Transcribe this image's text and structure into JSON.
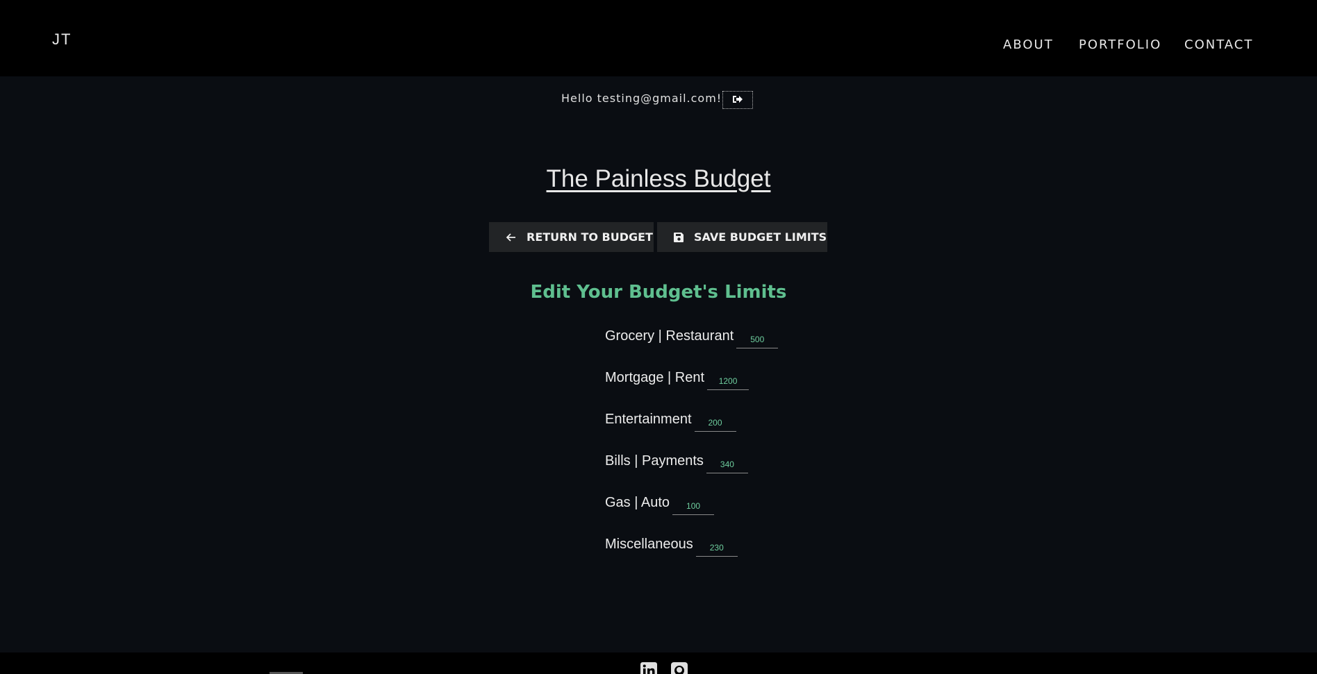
{
  "header": {
    "logo": "JT",
    "nav": [
      "ABOUT",
      "PORTFOLIO",
      "CONTACT"
    ]
  },
  "user": {
    "greeting": "Hello testing@gmail.com!",
    "logout_icon": "sign-out-icon"
  },
  "page": {
    "title": "The Painless Budget",
    "return_label": "RETURN TO BUDGET",
    "return_icon": "arrow-left-icon",
    "save_label": "SAVE BUDGET LIMITS",
    "save_icon": "floppy-disk-icon",
    "subheading": "Edit Your Budget's Limits"
  },
  "limits": [
    {
      "label": "Grocery | Restaurant",
      "value": "500"
    },
    {
      "label": "Mortgage | Rent",
      "value": "1200"
    },
    {
      "label": "Entertainment",
      "value": "200"
    },
    {
      "label": "Bills | Payments",
      "value": "340"
    },
    {
      "label": "Gas | Auto",
      "value": "100"
    },
    {
      "label": "Miscellaneous",
      "value": "230"
    }
  ],
  "footer": {
    "icons": [
      "linkedin-icon",
      "github-icon"
    ]
  },
  "colors": {
    "accent": "#5fbf8f",
    "background": "#0a0d12",
    "bar": "#000000"
  }
}
